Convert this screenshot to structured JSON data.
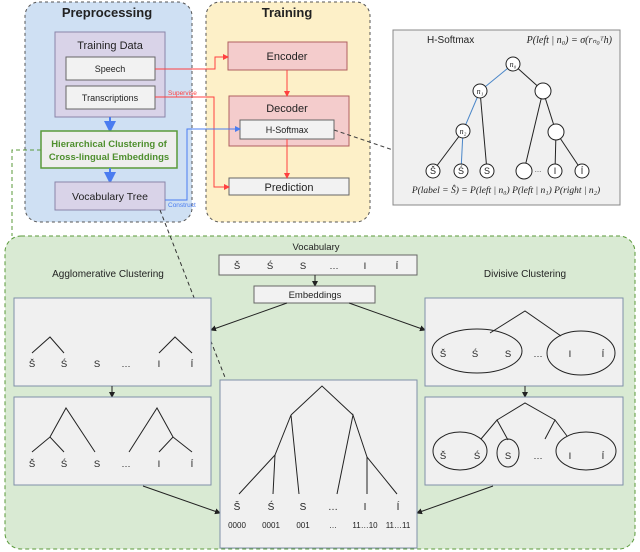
{
  "preprocessing": {
    "title": "Preprocessing",
    "training_data": "Training Data",
    "speech": "Speech",
    "transcriptions": "Transcriptions",
    "clustering_line1": "Hierarchical Clustering of",
    "clustering_line2": "Cross-lingual Embeddings",
    "vocab_tree": "Vocabulary Tree"
  },
  "training": {
    "title": "Training",
    "encoder": "Encoder",
    "decoder": "Decoder",
    "hsoftmax": "H-Softmax",
    "prediction": "Prediction",
    "supervise": "Supervise",
    "construct": "Construct"
  },
  "hsoftmax_panel": {
    "title": "H-Softmax",
    "formula_top": "P(left | n₀) = σ(rₙ₀ᵀh)",
    "formula_bottom": "P(label = Ŝ) = P(left | n₀) P(left | n₁) P(right | n₂)",
    "nodes": [
      "n₀",
      "n₁",
      "n₂"
    ],
    "leaves": [
      "Š",
      "Ś",
      "S",
      "",
      "…",
      "I",
      "Í"
    ]
  },
  "clustering": {
    "vocabulary_label": "Vocabulary",
    "vocabulary": [
      "Š",
      "Ś",
      "S",
      "…",
      "I",
      "Í"
    ],
    "embeddings": "Embeddings",
    "agglomerative": "Agglomerative Clustering",
    "divisive": "Divisive Clustering",
    "codes": [
      "0000",
      "0001",
      "001",
      "…",
      "11…10",
      "11…11"
    ]
  },
  "colors": {
    "preprocessing_bg": "#cfe0f3",
    "training_bg": "#fdf0c8",
    "clustering_bg": "#d9ead3",
    "supervise": "#ff4040",
    "construct": "#4a7cf0",
    "clustering_text": "#4e8f2e"
  }
}
